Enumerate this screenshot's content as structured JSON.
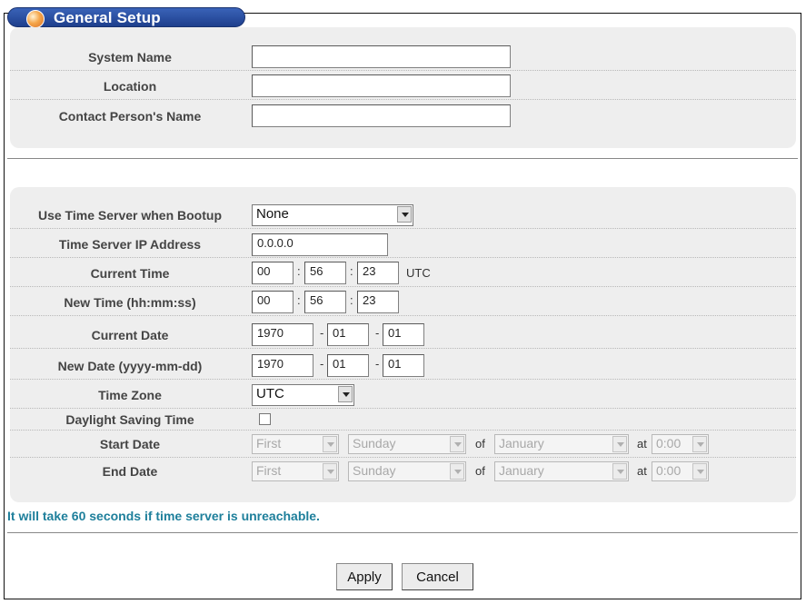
{
  "page_title": "General Setup",
  "general": {
    "system_name_label": "System Name",
    "system_name_value": "",
    "location_label": "Location",
    "location_value": "",
    "contact_label": "Contact Person's Name",
    "contact_value": ""
  },
  "time": {
    "time_server_label": "Use Time Server when Bootup",
    "time_server_value": "None",
    "ip_label": "Time Server IP Address",
    "ip_value": "0.0.0.0",
    "current_time_label": "Current Time",
    "current_time": {
      "hh": "00",
      "mm": "56",
      "ss": "23",
      "unit": "UTC"
    },
    "new_time_label": "New Time (hh:mm:ss)",
    "new_time": {
      "hh": "00",
      "mm": "56",
      "ss": "23"
    },
    "current_date_label": "Current Date",
    "current_date": {
      "yyyy": "1970",
      "mm": "01",
      "dd": "01"
    },
    "new_date_label": "New Date (yyyy-mm-dd)",
    "new_date": {
      "yyyy": "1970",
      "mm": "01",
      "dd": "01"
    },
    "time_zone_label": "Time Zone",
    "time_zone_value": "UTC",
    "dst_label": "Daylight Saving Time",
    "dst_checked": false,
    "start_date_label": "Start Date",
    "start": {
      "week": "First",
      "day": "Sunday",
      "of": "of",
      "month": "January",
      "at": "at",
      "time": "0:00"
    },
    "end_date_label": "End Date",
    "end": {
      "week": "First",
      "day": "Sunday",
      "of": "of",
      "month": "January",
      "at": "at",
      "time": "0:00"
    }
  },
  "note": "It will take 60 seconds if time server is unreachable.",
  "buttons": {
    "apply": "Apply",
    "cancel": "Cancel"
  },
  "colors": {
    "title_bar": "#2a4fa3",
    "note": "#1e7f9b",
    "panel": "#eeeeee"
  }
}
